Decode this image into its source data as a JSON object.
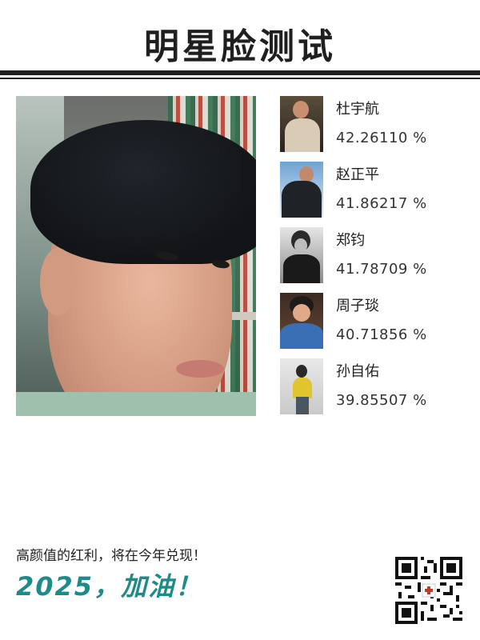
{
  "header": {
    "title": "明星脸测试"
  },
  "main_photo": {
    "icon": "selfie-photo"
  },
  "results": [
    {
      "name": "杜宇航",
      "score": "42.26110 %",
      "thumb_icon": "celebrity-photo"
    },
    {
      "name": "赵正平",
      "score": "41.86217 %",
      "thumb_icon": "celebrity-photo"
    },
    {
      "name": "郑钧",
      "score": "41.78709 %",
      "thumb_icon": "celebrity-photo"
    },
    {
      "name": "周子琰",
      "score": "40.71856 %",
      "thumb_icon": "celebrity-photo"
    },
    {
      "name": "孙自佑",
      "score": "39.85507 %",
      "thumb_icon": "celebrity-photo"
    }
  ],
  "footer": {
    "slogan": "高颜值的红利，将在今年兑现！",
    "cheer": "2025，加油！",
    "qr_icon": "qr-code-icon"
  },
  "colors": {
    "title": "#1f1f1f",
    "cheer": "#1f8a8a",
    "rule": "#1f1f1f"
  }
}
